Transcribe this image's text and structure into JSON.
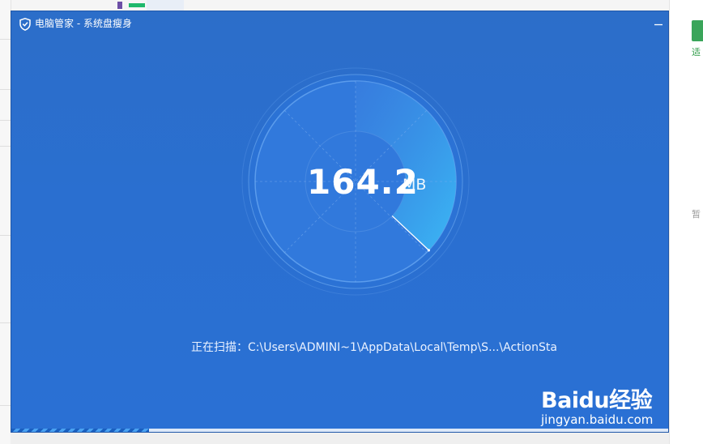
{
  "window": {
    "title": "电脑管家 - 系统盘瘦身"
  },
  "gauge": {
    "value": "164.2",
    "unit": "MB",
    "fill_fraction": 0.37
  },
  "scan": {
    "label": "正在扫描：",
    "path": "C:\\Users\\ADMINI~1\\AppData\\Local\\Temp\\S...\\ActionSta"
  },
  "progress": {
    "value": 0.21
  },
  "watermark": {
    "brand": "Baidu经验",
    "url": "jingyan.baidu.com"
  },
  "background": {
    "right_fragment_1": "适",
    "right_fragment_2": "暂"
  },
  "colors": {
    "window_bg": "#2a6fd0",
    "gauge_accent": "#3ab3f2",
    "text": "#ffffff"
  },
  "icons": {
    "logo": "shield-icon",
    "minimize": "minimize-icon",
    "close": "close-icon"
  }
}
